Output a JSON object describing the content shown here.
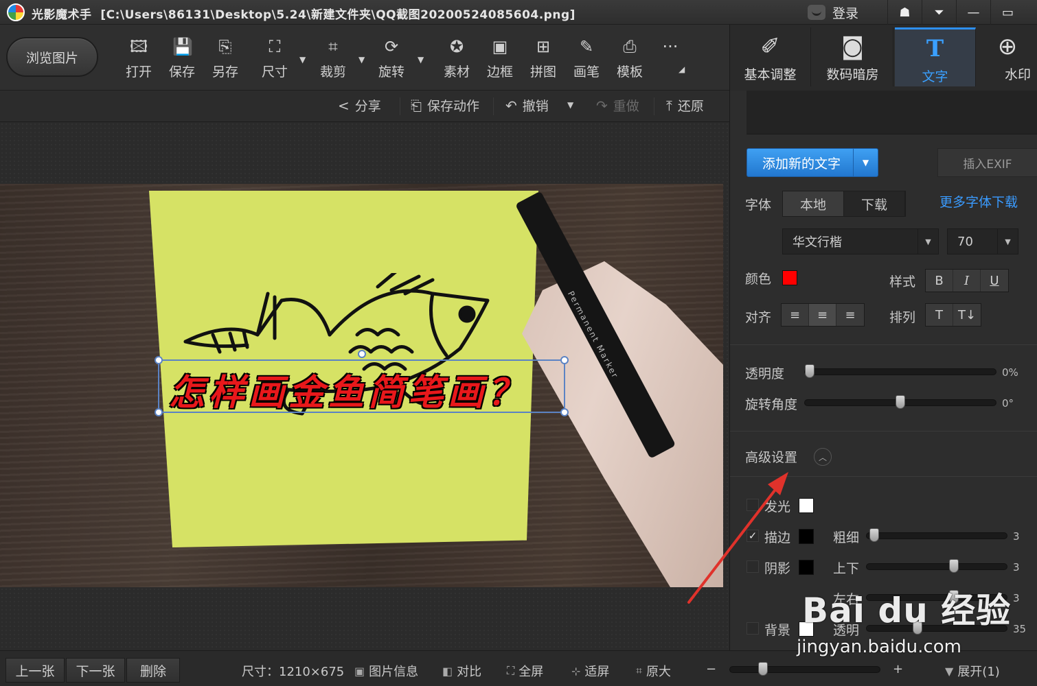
{
  "window": {
    "app_name": "光影魔术手",
    "file_path": "[C:\\Users\\86131\\Desktop\\5.24\\新建文件夹\\QQ截图20200524085604.png]",
    "login_label": "登录",
    "controls": {
      "skin": "☗",
      "menu": "⏷",
      "minimize": "—",
      "maximize": "▭"
    }
  },
  "toolbar": {
    "browse_label": "浏览图片",
    "tools": [
      {
        "label": "打开",
        "icon": "open-image-icon",
        "glyph": "🖾"
      },
      {
        "label": "保存",
        "icon": "save-icon",
        "glyph": "💾"
      },
      {
        "label": "另存",
        "icon": "save-as-icon",
        "glyph": "⎘"
      },
      {
        "label": "尺寸",
        "icon": "resize-icon",
        "glyph": "⛶"
      },
      {
        "label": "裁剪",
        "icon": "crop-icon",
        "glyph": "⌗"
      },
      {
        "label": "旋转",
        "icon": "rotate-icon",
        "glyph": "⟳"
      },
      {
        "label": "素材",
        "icon": "material-icon",
        "glyph": "✪"
      },
      {
        "label": "边框",
        "icon": "border-icon",
        "glyph": "▣"
      },
      {
        "label": "拼图",
        "icon": "collage-icon",
        "glyph": "⊞"
      },
      {
        "label": "画笔",
        "icon": "brush-icon",
        "glyph": "✎"
      },
      {
        "label": "模板",
        "icon": "template-icon",
        "glyph": "⎙"
      }
    ],
    "more_glyph": "···"
  },
  "right_tabs": [
    {
      "label": "基本调整",
      "icon": "basic-adjust-icon",
      "glyph": "✐",
      "active": false
    },
    {
      "label": "数码暗房",
      "icon": "darkroom-icon",
      "glyph": "◙",
      "active": false
    },
    {
      "label": "文字",
      "icon": "text-tool-icon",
      "glyph": "T",
      "active": true
    },
    {
      "label": "水印",
      "icon": "watermark-icon",
      "glyph": "⊕",
      "active": false
    }
  ],
  "actions": {
    "share": "分享",
    "save_action": "保存动作",
    "undo": "撤销",
    "redo": "重做",
    "restore": "还原"
  },
  "canvas": {
    "overlay_text": "怎样画金鱼简笔画？",
    "marker_label": "Permanent Marker"
  },
  "panel": {
    "add_text_label": "添加新的文字",
    "insert_exif_label": "插入EXIF",
    "font_label": "字体",
    "font_source_tabs": [
      "本地",
      "下载"
    ],
    "font_source_active": 0,
    "more_fonts_link": "更多字体下载",
    "font_name": "华文行楷",
    "font_size": "70",
    "color_label": "颜色",
    "text_color": "#ff0000",
    "style_label": "样式",
    "style_buttons": [
      "B",
      "I",
      "U"
    ],
    "align_label": "对齐",
    "align_buttons": [
      "≡",
      "≡",
      "≡"
    ],
    "arrange_label": "排列",
    "arrange_buttons": [
      "T",
      "T↓"
    ],
    "opacity_label": "透明度",
    "opacity_value": "0%",
    "opacity_fraction": 0.0,
    "rotation_label": "旋转角度",
    "rotation_value": "0°",
    "rotation_fraction": 0.5,
    "advanced_label": "高级设置",
    "advanced_toggle_glyph": "︿",
    "glow": {
      "label": "发光",
      "checked": false,
      "color": "#ffffff"
    },
    "stroke": {
      "label": "描边",
      "checked": true,
      "color": "#000000",
      "sub_label": "粗细",
      "value": "3",
      "fraction": 0.02
    },
    "shadow": {
      "label": "阴影",
      "checked": false,
      "color": "#000000",
      "updown_label": "上下",
      "updown_value": "3",
      "updown_fraction": 0.63,
      "leftright_label": "左右",
      "leftright_value": "3",
      "leftright_fraction": 0.63
    },
    "background": {
      "label": "背景",
      "checked": false,
      "color": "#ffffff",
      "sub_label": "透明",
      "value": "35",
      "fraction": 0.35
    }
  },
  "statusbar": {
    "prev_label": "上一张",
    "next_label": "下一张",
    "delete_label": "删除",
    "size_text": "尺寸：1210×675",
    "info_label": "图片信息",
    "compare_label": "对比",
    "fullscreen_label": "全屏",
    "fit_label": "适屏",
    "original_label": "原大",
    "zoom_minus": "−",
    "zoom_plus": "+",
    "zoom_fraction": 0.2,
    "expand_label": "展开(1)"
  },
  "watermark": {
    "logo_text": "Bai du 经验",
    "url": "jingyan.baidu.com"
  },
  "colors": {
    "accent": "#2d8ff0",
    "annotation_arrow": "#e0322b"
  }
}
